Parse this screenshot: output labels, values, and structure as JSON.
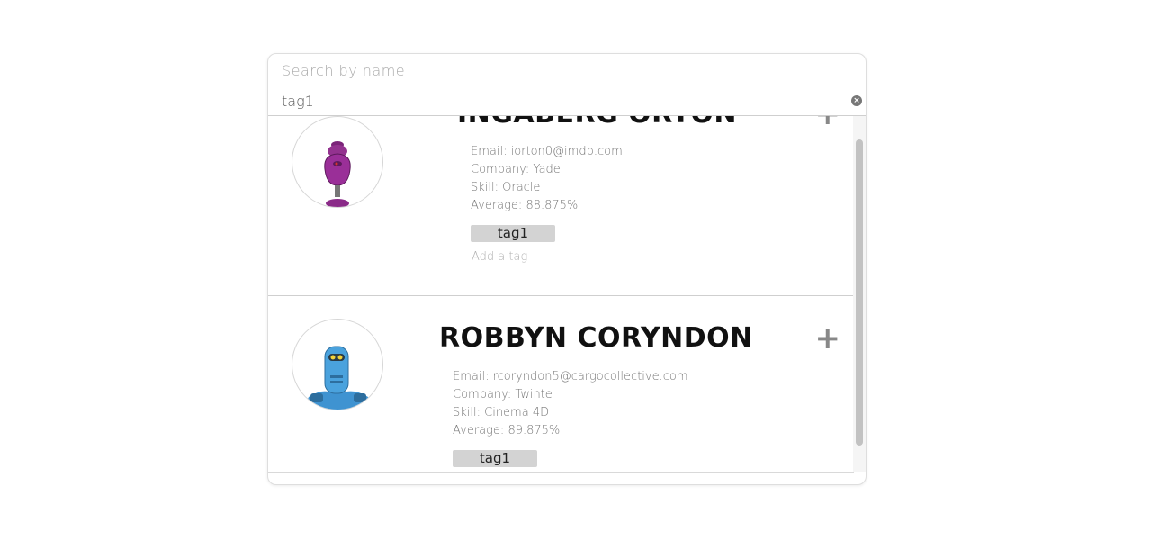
{
  "search": {
    "name_placeholder": "Search by name",
    "tag_value": "tag1",
    "clear_symbol": "×"
  },
  "students": [
    {
      "name": "INGABERG ORTON",
      "email": "Email: iorton0@imdb.com",
      "company": "Company: Yadel",
      "skill": "Skill: Oracle",
      "average": "Average: 88.875%",
      "tags": [
        "tag1"
      ],
      "add_tag_placeholder": "Add a tag",
      "expand_symbol": "+",
      "avatar_icon": "purple-robot-avatar",
      "avatar_color": "#8e2f8a"
    },
    {
      "name": "ROBBYN CORYNDON",
      "email": "Email: rcoryndon5@cargocollective.com",
      "company": "Company: Twinte",
      "skill": "Skill: Cinema 4D",
      "average": "Average: 89.875%",
      "tags": [
        "tag1"
      ],
      "expand_symbol": "+",
      "avatar_icon": "blue-robot-avatar",
      "avatar_color": "#3a8fcf"
    }
  ]
}
